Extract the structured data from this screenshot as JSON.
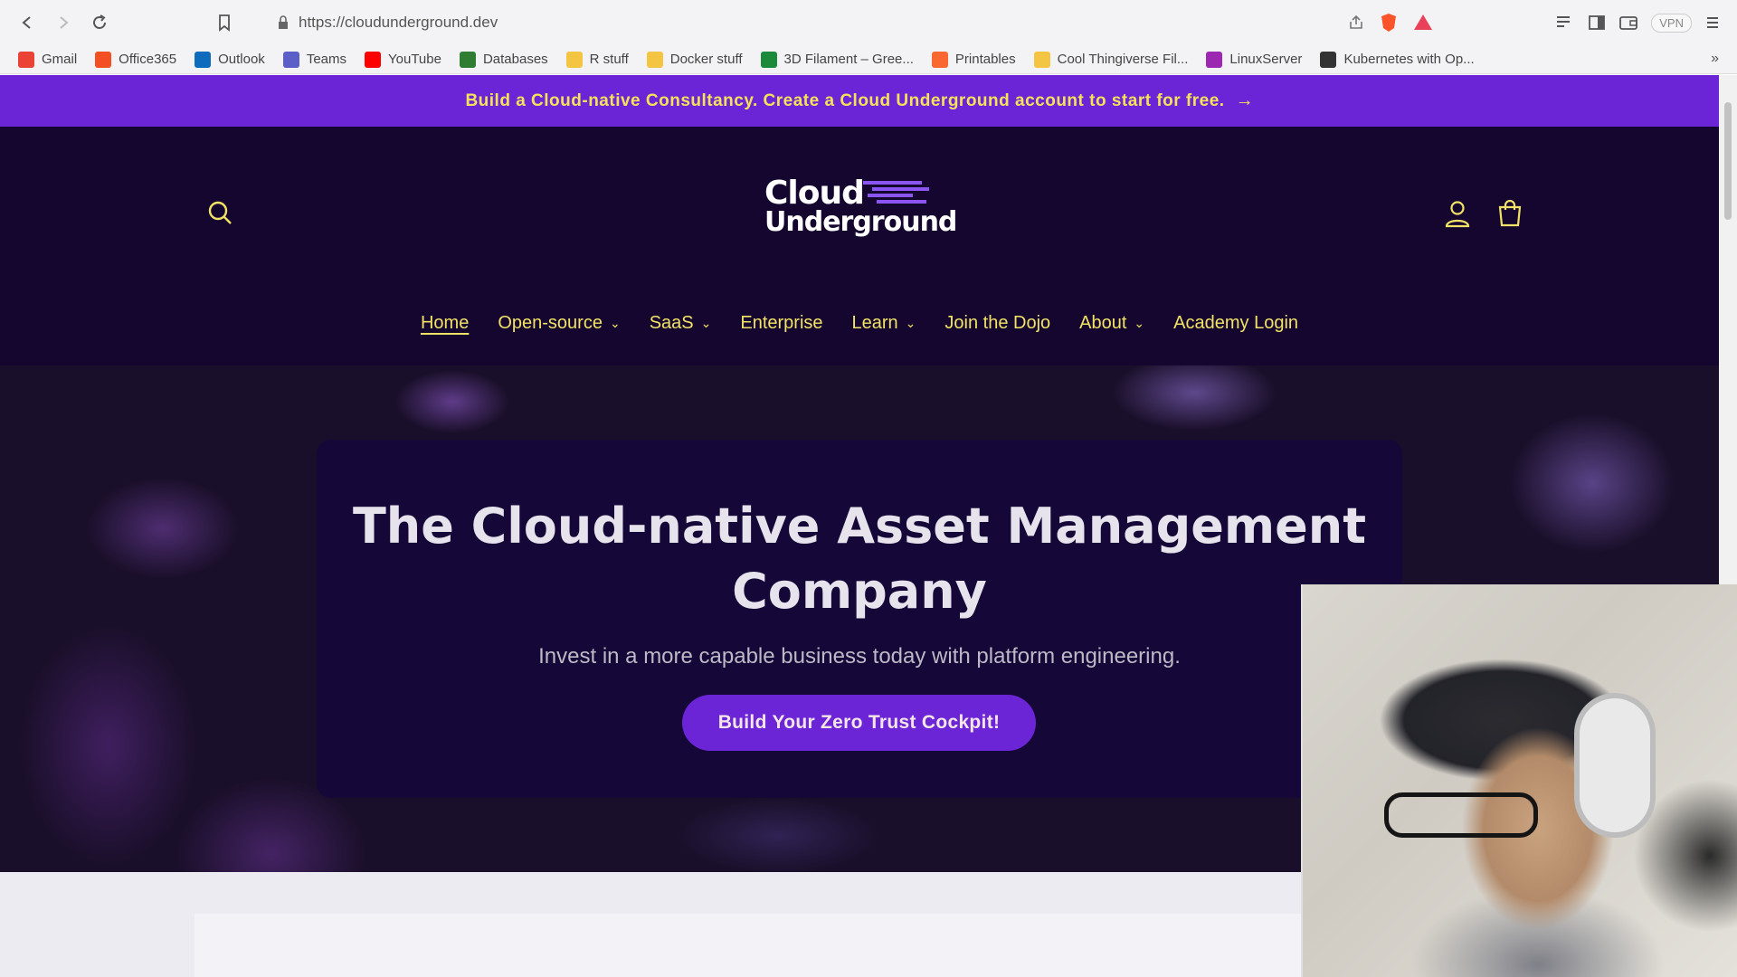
{
  "browser": {
    "url": "https://cloudunderground.dev",
    "vpn_label": "VPN",
    "bookmarks": [
      {
        "label": "Gmail",
        "color": "#ea4335"
      },
      {
        "label": "Office365",
        "color": "#f25022"
      },
      {
        "label": "Outlook",
        "color": "#0f6cbd"
      },
      {
        "label": "Teams",
        "color": "#5b5fc7"
      },
      {
        "label": "YouTube",
        "color": "#ff0000"
      },
      {
        "label": "Databases",
        "color": "#2e7d32"
      },
      {
        "label": "R stuff",
        "color": "#f4c542"
      },
      {
        "label": "Docker stuff",
        "color": "#f4c542"
      },
      {
        "label": "3D Filament – Gree...",
        "color": "#1b8a3a"
      },
      {
        "label": "Printables",
        "color": "#fa6831"
      },
      {
        "label": "Cool Thingiverse Fil...",
        "color": "#f4c542"
      },
      {
        "label": "LinuxServer",
        "color": "#9c27b0"
      },
      {
        "label": "Kubernetes with Op...",
        "color": "#333333"
      }
    ]
  },
  "announcement": {
    "text": "Build a Cloud-native Consultancy. Create a Cloud Underground account to start for free.",
    "arrow": "→"
  },
  "header": {
    "logo_line1": "Cloud",
    "logo_line2": "Underground",
    "nav": [
      {
        "label": "Home",
        "has_dropdown": false,
        "active": true
      },
      {
        "label": "Open-source",
        "has_dropdown": true
      },
      {
        "label": "SaaS",
        "has_dropdown": true
      },
      {
        "label": "Enterprise",
        "has_dropdown": false
      },
      {
        "label": "Learn",
        "has_dropdown": true
      },
      {
        "label": "Join the Dojo",
        "has_dropdown": false
      },
      {
        "label": "About",
        "has_dropdown": true
      },
      {
        "label": "Academy Login",
        "has_dropdown": false
      }
    ]
  },
  "hero": {
    "title_line1": "The Cloud-native Asset Management",
    "title_line2": "Company",
    "subtitle": "Invest in a more capable business today with platform engineering.",
    "cta": "Build Your Zero Trust Cockpit!"
  },
  "colors": {
    "accent": "#6c25d6",
    "nav_text": "#f2e267",
    "background": "#14062e"
  }
}
